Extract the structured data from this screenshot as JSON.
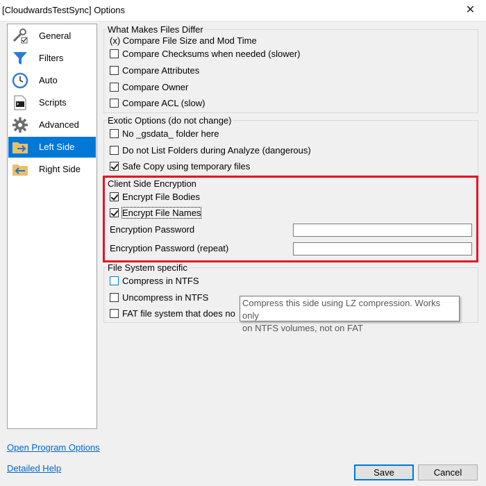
{
  "window": {
    "title": "[CloudwardsTestSync] Options",
    "close_glyph": "✕"
  },
  "sidebar": {
    "items": [
      {
        "label": "General",
        "icon": "wrench-icon"
      },
      {
        "label": "Filters",
        "icon": "funnel-icon"
      },
      {
        "label": "Auto",
        "icon": "clock-icon"
      },
      {
        "label": "Scripts",
        "icon": "script-icon"
      },
      {
        "label": "Advanced",
        "icon": "gear-icon"
      },
      {
        "label": "Left Side",
        "icon": "folder-left-icon",
        "selected": true
      },
      {
        "label": "Right Side",
        "icon": "folder-right-icon"
      }
    ]
  },
  "differ": {
    "title": "What Makes Files Differ",
    "fixed_line": "(x) Compare File Size and Mod Time",
    "options": [
      {
        "label": "Compare Checksums when needed (slower)",
        "checked": false
      },
      {
        "label": "Compare Attributes",
        "checked": false
      },
      {
        "label": "Compare Owner",
        "checked": false
      },
      {
        "label": "Compare ACL (slow)",
        "checked": false
      }
    ]
  },
  "exotic": {
    "title": "Exotic Options (do not change)",
    "options": [
      {
        "label": "No _gsdata_ folder here",
        "checked": false
      },
      {
        "label": "Do not List Folders during Analyze (dangerous)",
        "checked": false
      },
      {
        "label": "Safe Copy using temporary files",
        "checked": true
      }
    ]
  },
  "encryption": {
    "title": "Client Side Encryption",
    "options": [
      {
        "label": "Encrypt File Bodies",
        "checked": true
      },
      {
        "label": "Encrypt File Names",
        "checked": true
      }
    ],
    "password_label": "Encryption Password",
    "password_repeat_label": "Encryption Password (repeat)",
    "password_value": "",
    "password_repeat_value": "",
    "highlight_color": "#e81123"
  },
  "filesystem": {
    "title": "File System specific",
    "options": [
      {
        "label": "Compress in NTFS",
        "checked": false
      },
      {
        "label": "Uncompress in NTFS",
        "checked": false
      },
      {
        "label": "FAT file system that does no",
        "checked": false
      }
    ]
  },
  "tooltip": {
    "line1": "Compress this side using LZ compression. Works only",
    "line2": "on NTFS volumes, not on FAT"
  },
  "links": {
    "open_program_options": "Open Program Options",
    "detailed_help": "Detailed Help"
  },
  "buttons": {
    "save": "Save",
    "cancel": "Cancel"
  },
  "colors": {
    "accent": "#0078d7",
    "link": "#0066cc"
  }
}
